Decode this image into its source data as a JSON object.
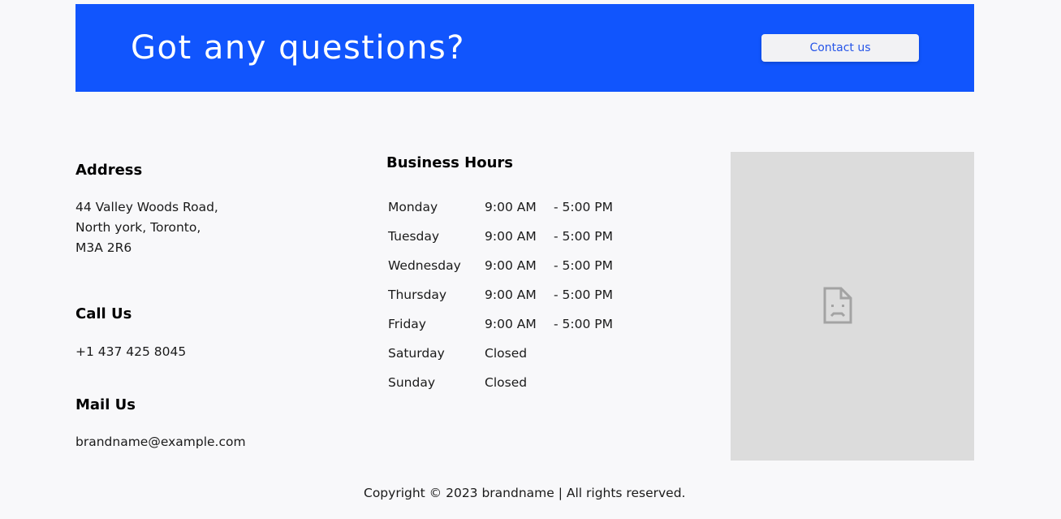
{
  "banner": {
    "title": "Got any questions?",
    "button_label": "Contact us",
    "background_color": "#1155fd"
  },
  "address": {
    "heading": "Address",
    "lines": [
      "44 Valley Woods Road,",
      "North york, Toronto,",
      "M3A 2R6"
    ]
  },
  "call": {
    "heading": "Call Us",
    "phone": "+1 437 425 8045"
  },
  "mail": {
    "heading": "Mail Us",
    "email": "brandname@example.com"
  },
  "hours": {
    "heading": "Business Hours",
    "rows": [
      {
        "day": "Monday",
        "open": "9:00 AM",
        "close": "- 5:00 PM"
      },
      {
        "day": "Tuesday",
        "open": "9:00 AM",
        "close": "- 5:00 PM"
      },
      {
        "day": "Wednesday",
        "open": "9:00 AM",
        "close": "- 5:00 PM"
      },
      {
        "day": "Thursday",
        "open": "9:00 AM",
        "close": "- 5:00 PM"
      },
      {
        "day": "Friday",
        "open": "9:00 AM",
        "close": "- 5:00 PM"
      },
      {
        "day": "Saturday",
        "open": "Closed",
        "close": ""
      },
      {
        "day": "Sunday",
        "open": "Closed",
        "close": ""
      }
    ]
  },
  "map": {
    "icon": "broken-page-icon"
  },
  "footer": {
    "copyright": "Copyright © 2023 brandname | All rights reserved."
  }
}
